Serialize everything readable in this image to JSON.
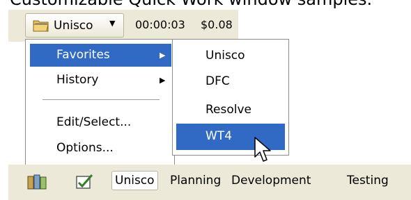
{
  "caption": "Customizable Quick Work window samples.",
  "toolbar_top": {
    "dropdown_label": "Unisco",
    "timer": "00:00:03",
    "cost": "$0.08"
  },
  "menu": {
    "items": [
      {
        "label": "Favorites",
        "has_submenu": true,
        "selected": true
      },
      {
        "label": "History",
        "has_submenu": true,
        "selected": false
      },
      {
        "label": "Edit/Select...",
        "has_submenu": false,
        "selected": false
      },
      {
        "label": "Options...",
        "has_submenu": false,
        "selected": false
      }
    ]
  },
  "submenu": {
    "items": [
      {
        "label": "Unisco",
        "selected": false
      },
      {
        "label": "DFC",
        "selected": false
      },
      {
        "label": "Resolve",
        "selected": false
      },
      {
        "label": "WT4",
        "selected": true
      }
    ]
  },
  "toolbar_bottom": {
    "icons": [
      "columns-icon",
      "checkbox-icon"
    ],
    "tabs": [
      {
        "label": "Unisco",
        "active": true
      },
      {
        "label": "Planning",
        "active": false
      },
      {
        "label": "Development",
        "active": false
      },
      {
        "label": "Testing",
        "active": false
      }
    ]
  },
  "colors": {
    "accent_blue": "#0b4ed2",
    "selection": "#316ac5",
    "toolbar_bg": "#ece9d8"
  }
}
